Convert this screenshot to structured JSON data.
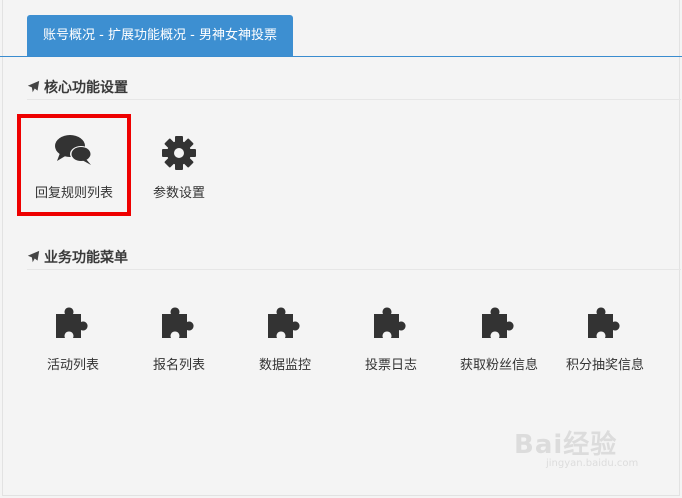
{
  "tabs": [
    {
      "label": "账号概况 - 扩展功能概况 - 男神女神投票",
      "active": true
    }
  ],
  "sections": [
    {
      "title": "核心功能设置",
      "items": [
        {
          "label": "回复规则列表",
          "icon": "chat-bubbles-icon"
        },
        {
          "label": "参数设置",
          "icon": "gear-icon"
        }
      ]
    },
    {
      "title": "业务功能菜单",
      "items": [
        {
          "label": "活动列表",
          "icon": "puzzle-icon"
        },
        {
          "label": "报名列表",
          "icon": "puzzle-icon"
        },
        {
          "label": "数据监控",
          "icon": "puzzle-icon"
        },
        {
          "label": "投票日志",
          "icon": "puzzle-icon"
        },
        {
          "label": "获取粉丝信息",
          "icon": "puzzle-icon"
        },
        {
          "label": "积分抽奖信息",
          "icon": "puzzle-icon"
        }
      ]
    }
  ],
  "highlight": {
    "target": "回复规则列表",
    "color": "#ee0000"
  },
  "watermark": {
    "text": "Bai经验",
    "url": "jingyan.baidu.com"
  },
  "colors": {
    "accent": "#3d8fd1",
    "icon": "#333333",
    "background": "#f4f4f4"
  }
}
